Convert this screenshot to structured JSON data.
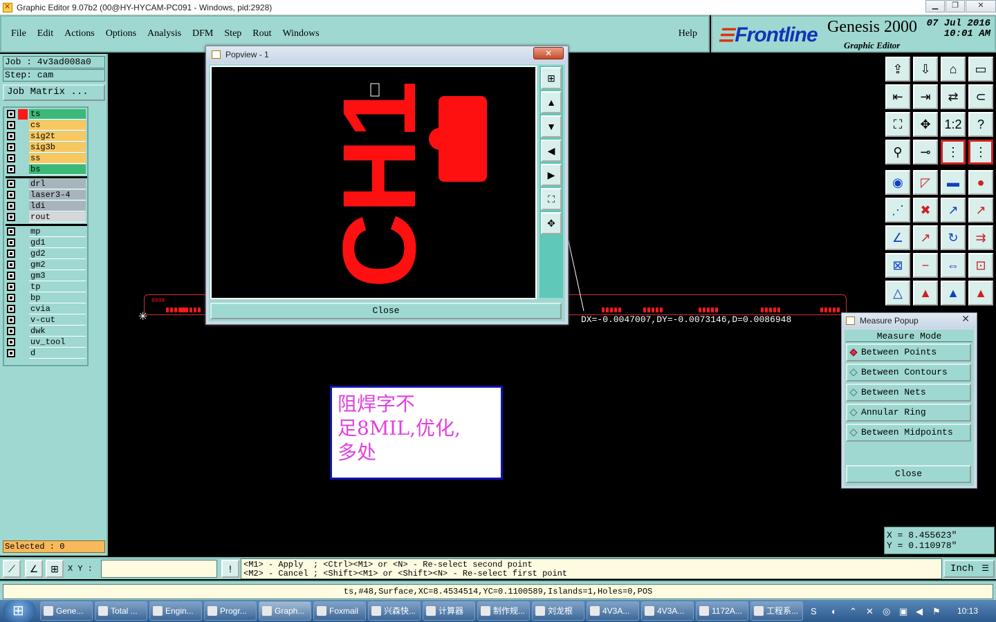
{
  "window": {
    "title": "Graphic Editor 9.07b2 (00@HY-HYCAM-PC091 - Windows, pid:2928)"
  },
  "menu": {
    "items": [
      "File",
      "Edit",
      "Actions",
      "Options",
      "Analysis",
      "DFM",
      "Step",
      "Rout",
      "Windows"
    ],
    "help": "Help"
  },
  "brand": {
    "logo": "Frontline",
    "product": "Genesis 2000",
    "subtitle": "Graphic Editor",
    "date": "07 Jul 2016",
    "time": "10:01 AM"
  },
  "job": {
    "job_label": "Job : 4v3ad008a0",
    "step_label": "Step: cam",
    "matrix_button": "Job Matrix ..."
  },
  "layers": {
    "group1": [
      {
        "name": "ts",
        "color": "#3cb878"
      },
      {
        "name": "cs",
        "color": "#f8c860"
      },
      {
        "name": "sig2t",
        "color": "#f8c860"
      },
      {
        "name": "sig3b",
        "color": "#f8c860"
      },
      {
        "name": "ss",
        "color": "#f8c860"
      },
      {
        "name": "bs",
        "color": "#3cb878"
      }
    ],
    "group2": [
      {
        "name": "drl",
        "color": "#a8b4bc"
      },
      {
        "name": "laser3-4",
        "color": "#a8b4bc"
      },
      {
        "name": "ldi",
        "color": "#a8b4bc"
      },
      {
        "name": "rout",
        "color": "#d4d8d8"
      }
    ],
    "group3": [
      {
        "name": "mp",
        "color": "#9fd8d0"
      },
      {
        "name": "gd1",
        "color": "#9fd8d0"
      },
      {
        "name": "gd2",
        "color": "#9fd8d0"
      },
      {
        "name": "gm2",
        "color": "#9fd8d0"
      },
      {
        "name": "gm3",
        "color": "#9fd8d0"
      },
      {
        "name": "tp",
        "color": "#9fd8d0"
      },
      {
        "name": "bp",
        "color": "#9fd8d0"
      },
      {
        "name": "cvia",
        "color": "#9fd8d0"
      },
      {
        "name": "v-cut",
        "color": "#9fd8d0"
      },
      {
        "name": "dwk",
        "color": "#9fd8d0"
      },
      {
        "name": "uv_tool",
        "color": "#9fd8d0"
      },
      {
        "name": "d",
        "color": "#9fd8d0"
      }
    ]
  },
  "selected": "Selected : 0",
  "popview": {
    "title": "Popview - 1",
    "close": "Close",
    "pcb_text": "CH1"
  },
  "measure_readout": "DX=-0.0047007,DY=-0.0073146,D=0.0086948",
  "pcb_label": "8888",
  "note": {
    "line1": "阻焊字不",
    "line2": "足8MIL,优化,",
    "line3": "多处"
  },
  "measure_popup": {
    "title": "Measure Popup",
    "header": "Measure Mode",
    "options": [
      "Between Points",
      "Between Contours",
      "Between Nets",
      "Annular Ring",
      "Between Midpoints"
    ],
    "selected_index": 0,
    "close": "Close"
  },
  "coords": {
    "x": "X = 8.455623\"",
    "y": "Y = 0.110978\""
  },
  "cmdbar": {
    "xy_label": "X Y :",
    "xy_value": "",
    "hint_line1": "<M1> - Apply  ; <Ctrl><M1> or <N> - Re-select second point",
    "hint_line2": "<M2> - Cancel ; <Shift><M1> or <Shift><N> - Re-select first point",
    "unit": "Inch"
  },
  "status": "ts,#48,Surface,XC=8.4534514,YC=0.1100589,Islands=1,Holes=0,POS",
  "taskbar": {
    "tasks": [
      "Gene...",
      "Total ...",
      "Engin...",
      "Progr...",
      "Graph...",
      "Foxmail",
      "兴森快...",
      "计算器",
      "制作规...",
      "刘龙根",
      "4V3A...",
      "4V3A...",
      "1172A...",
      "工程系..."
    ],
    "clock": "10:13"
  },
  "colors": {
    "panel": "#9fd8d0",
    "copper": "#ff1818",
    "note_text": "#e040e0"
  }
}
